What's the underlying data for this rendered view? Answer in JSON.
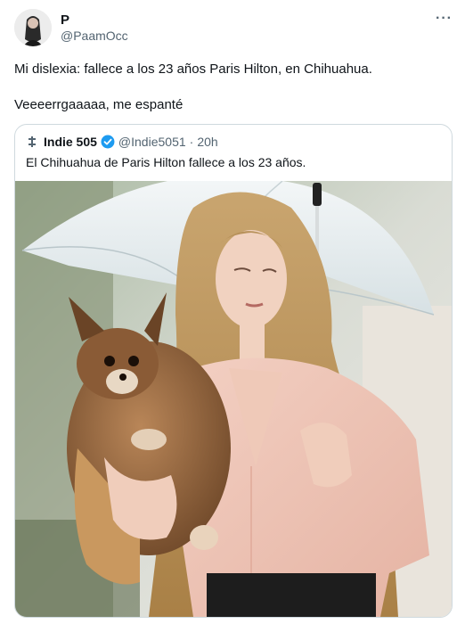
{
  "author": {
    "name": "P",
    "handle": "@PaamOcc"
  },
  "more_label": "···",
  "tweet_text": "Mi dislexia: fallece a los 23 años Paris Hilton, en Chihuahua.\n\nVeeeerrgaaaaa, me espanté",
  "quoted": {
    "name": "Indie 505",
    "handle": "@Indie5051",
    "separator": "·",
    "time": "20h",
    "text": "El Chihuahua de Paris Hilton fallece a los 23 años."
  },
  "colors": {
    "verified": "#1d9bf0",
    "secondary_text": "#536471",
    "border": "#cfd9de"
  },
  "icons": {
    "more": "more-horizontal-icon",
    "verified": "verified-badge-icon",
    "quoted_avatar": "quoted-logo-icon"
  }
}
